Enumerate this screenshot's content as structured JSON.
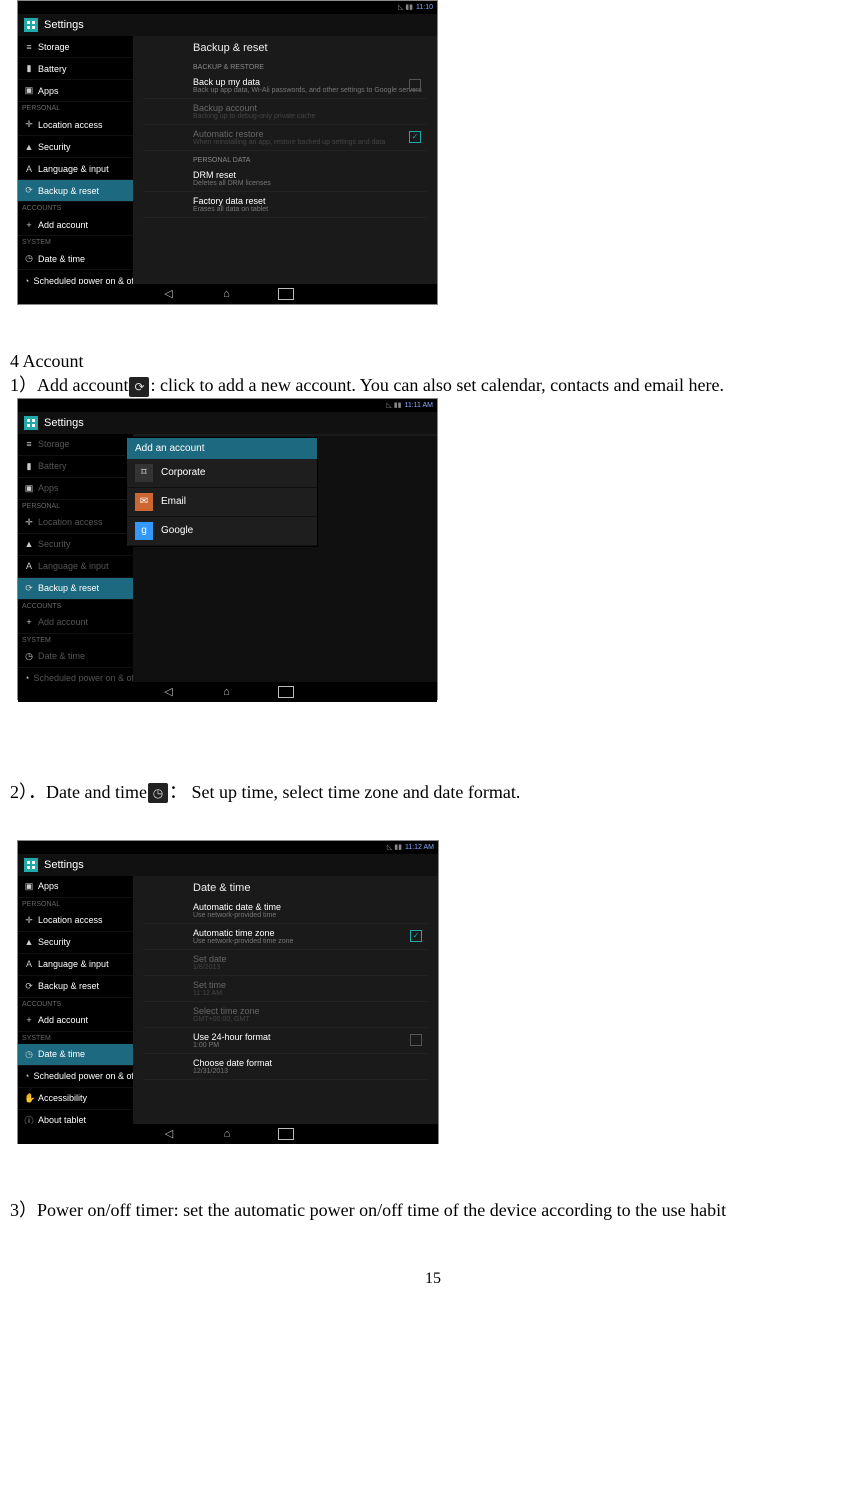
{
  "doc": {
    "sec4_heading": "4  Account",
    "item1_prefix": "1）Add account",
    "item1_suffix": ": click to add a new account. You can also set calendar, contacts and email here.",
    "item2_prefix": "2）．Date and time",
    "item2_suffix": "：  Set up time, select time zone and date format.",
    "item3_text": "3）Power on/off timer: set the automatic power on/off time of the device according to the use habit",
    "page_number": "15"
  },
  "status": {
    "time1": "11:10",
    "time2": "11:11 AM",
    "time3": "11:12 AM"
  },
  "settings_title": "Settings",
  "sidebar": {
    "items": [
      {
        "icon": "≡",
        "label": "Storage"
      },
      {
        "icon": "▮",
        "label": "Battery"
      },
      {
        "icon": "▣",
        "label": "Apps"
      }
    ],
    "personal_header": "PERSONAL",
    "personal": [
      {
        "icon": "✛",
        "label": "Location access"
      },
      {
        "icon": "▲",
        "label": "Security"
      },
      {
        "icon": "A",
        "label": "Language & input"
      },
      {
        "icon": "⟳",
        "label": "Backup & reset"
      }
    ],
    "accounts_header": "ACCOUNTS",
    "accounts": [
      {
        "icon": "+",
        "label": "Add account"
      }
    ],
    "system_header": "SYSTEM",
    "system": [
      {
        "icon": "◷",
        "label": "Date & time"
      },
      {
        "icon": "◔",
        "label": "Scheduled power on & off"
      },
      {
        "icon": "✋",
        "label": "Accessibility"
      }
    ],
    "about": {
      "icon": "ⓘ",
      "label": "About tablet"
    }
  },
  "s1": {
    "header": "Backup & reset",
    "cat1": "BACKUP & RESTORE",
    "i1_t": "Back up my data",
    "i1_s": "Back up app data, Wi-Ali passwords, and other settings to Google servers",
    "i2_t": "Backup account",
    "i2_s": "Backing up to debug-only private cache",
    "i3_t": "Automatic restore",
    "i3_s": "When reinstalling an app, restore backed up settings and data",
    "cat2": "PERSONAL DATA",
    "i4_t": "DRM reset",
    "i4_s": "Deletes all DRM licenses",
    "i5_t": "Factory data reset",
    "i5_s": "Erases all data on tablet"
  },
  "s2": {
    "dlg_head": "Add an account",
    "opt1": "Corporate",
    "opt2": "Email",
    "opt3": "Google"
  },
  "s3": {
    "header": "Date & time",
    "i1_t": "Automatic date & time",
    "i1_s": "Use network-provided time",
    "i2_t": "Automatic time zone",
    "i2_s": "Use network-provided time zone",
    "i3_t": "Set date",
    "i3_s": "1/8/2013",
    "i4_t": "Set time",
    "i4_s": "11:12 AM",
    "i5_t": "Select time zone",
    "i5_s": "GMT+00:00, GMT",
    "i6_t": "Use 24-hour format",
    "i6_s": "1:00 PM",
    "i7_t": "Choose date format",
    "i7_s": "12/31/2013"
  }
}
